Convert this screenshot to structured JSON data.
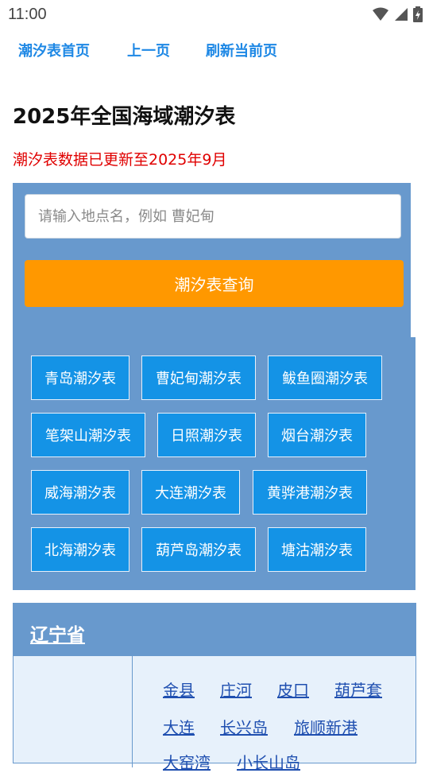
{
  "status_bar": {
    "time": "11:00"
  },
  "nav": {
    "home": "潮汐表首页",
    "prev": "上一页",
    "refresh": "刷新当前页"
  },
  "title": "2025年全国海域潮汐表",
  "notice": "潮汐表数据已更新至2025年9月",
  "search": {
    "placeholder": "请输入地点名，例如 曹妃甸",
    "button": "潮汐表查询"
  },
  "quick_links": [
    "青岛潮汐表",
    "曹妃甸潮汐表",
    "鲅鱼圈潮汐表",
    "笔架山潮汐表",
    "日照潮汐表",
    "烟台潮汐表",
    "威海潮汐表",
    "大连潮汐表",
    "黄骅港潮汐表",
    "北海潮汐表",
    "葫芦岛潮汐表",
    "塘沽潮汐表"
  ],
  "province": {
    "name": "辽宁省",
    "stations": [
      "金县",
      "庄河",
      "皮口",
      "葫芦套",
      "大连",
      "长兴岛",
      "旅顺新港",
      "大窑湾",
      "小长山岛"
    ]
  },
  "colors": {
    "link_blue": "#1e88e5",
    "panel": "#6899cd",
    "button_orange": "#ff9800",
    "chip_blue": "#1493e6",
    "notice_red": "#e00000"
  }
}
